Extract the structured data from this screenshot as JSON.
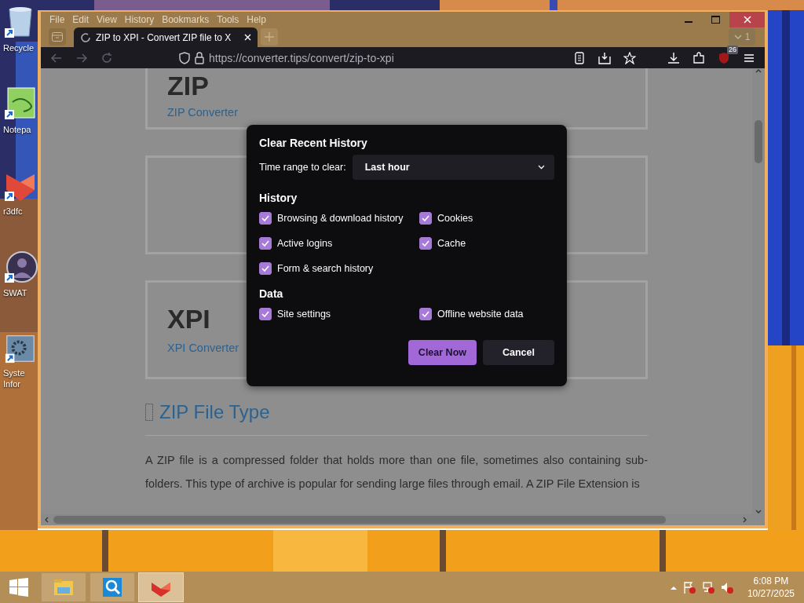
{
  "desktop": {
    "icons": [
      {
        "label": "Recycle",
        "kind": "bin"
      },
      {
        "label": "Notepa",
        "kind": "notepad"
      },
      {
        "label": "r3dfc",
        "kind": "redapp"
      },
      {
        "label": "SWAT",
        "kind": "avatar"
      },
      {
        "label": "Syste Infor",
        "kind": "gear"
      }
    ]
  },
  "browser": {
    "menu": [
      "File",
      "Edit",
      "View",
      "History",
      "Bookmarks",
      "Tools",
      "Help"
    ],
    "tabs": [
      {
        "title": "ZIP to XPI - Convert ZIP file to X",
        "selected": true
      }
    ],
    "tab_count": "1",
    "url": "https://converter.tips/convert/zip-to-xpi",
    "extension_badge": "26",
    "page": {
      "cards": [
        {
          "kind": "titled",
          "title": "ZIP",
          "link": "ZIP Converter"
        },
        {
          "kind": "empty"
        },
        {
          "kind": "titled",
          "title": "XPI",
          "link": "XPI Converter"
        }
      ],
      "section_heading": "ZIP File Type",
      "paragraph": "A ZIP file is a compressed folder that holds more than one file, sometimes also containing sub-folders. This type of archive is popular for sending large files through email. A ZIP File Extension is"
    }
  },
  "dialog": {
    "title": "Clear Recent History",
    "time_range_label": "Time range to clear:",
    "time_range_value": "Last hour",
    "sections": [
      {
        "heading": "History",
        "options": [
          {
            "label": "Browsing & download history",
            "checked": true
          },
          {
            "label": "Cookies",
            "checked": true
          },
          {
            "label": "Active logins",
            "checked": true
          },
          {
            "label": "Cache",
            "checked": true
          },
          {
            "label": "Form & search history",
            "checked": true
          }
        ]
      },
      {
        "heading": "Data",
        "options": [
          {
            "label": "Site settings",
            "checked": true
          },
          {
            "label": "Offline website data",
            "checked": true
          }
        ]
      }
    ],
    "buttons": [
      {
        "label": "Clear Now",
        "kind": "primary"
      },
      {
        "label": "Cancel",
        "kind": "secondary"
      }
    ]
  },
  "taskbar": {
    "apps": [
      {
        "kind": "folder",
        "selected": false
      },
      {
        "kind": "search",
        "selected": false
      },
      {
        "kind": "redapp",
        "selected": true
      }
    ],
    "time": "6:08 PM",
    "date": "10/27/2025"
  }
}
